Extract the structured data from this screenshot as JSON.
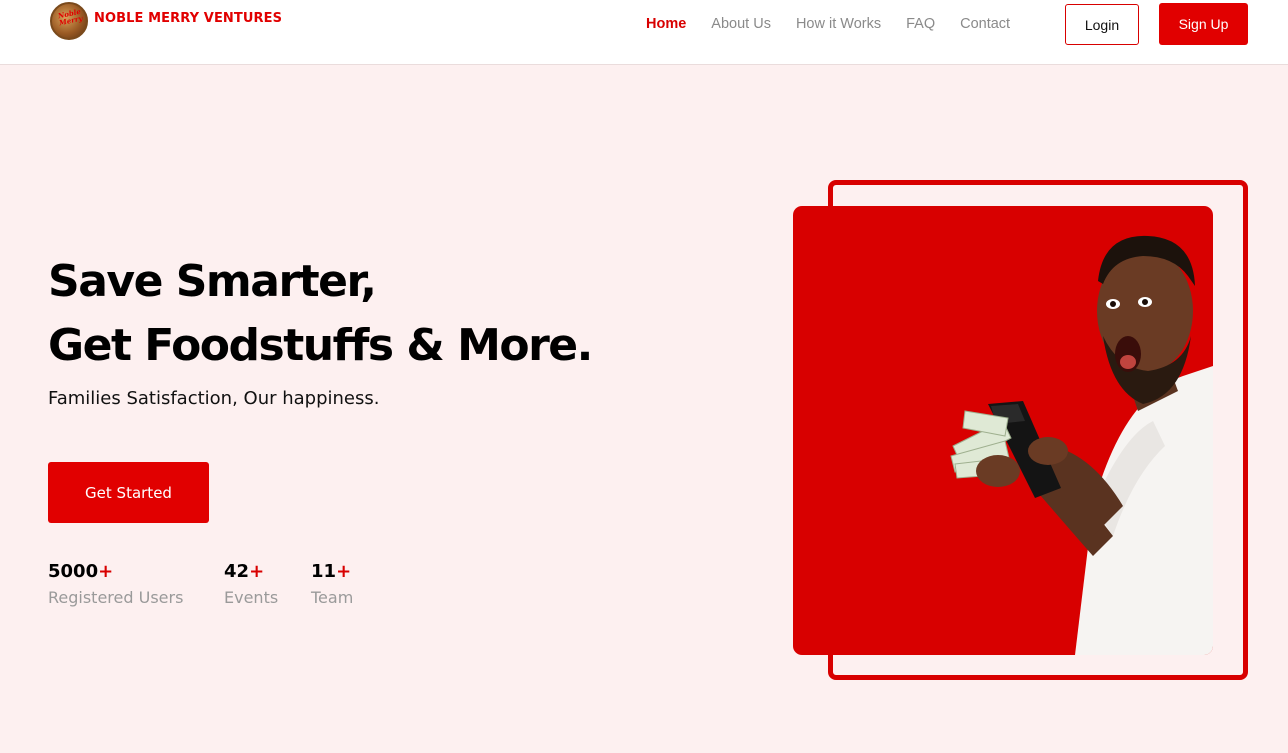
{
  "brand": {
    "name": "NOBLE MERRY VENTURES",
    "badge_text": "Noble Merry"
  },
  "nav": {
    "items": [
      {
        "label": "Home",
        "active": true
      },
      {
        "label": "About Us",
        "active": false
      },
      {
        "label": "How it Works",
        "active": false
      },
      {
        "label": "FAQ",
        "active": false
      },
      {
        "label": "Contact",
        "active": false
      }
    ],
    "login_label": "Login",
    "signup_label": "Sign Up"
  },
  "hero": {
    "title_line1": "Save Smarter,",
    "title_line2": "Get Foodstuffs & More.",
    "subtitle": "Families Satisfaction, Our happiness.",
    "cta_label": "Get Started",
    "image_icon": "man-holding-cash-wallet-photo"
  },
  "stats": [
    {
      "value": "5000",
      "suffix": "+",
      "label": "Registered Users"
    },
    {
      "value": "42",
      "suffix": "+",
      "label": "Events"
    },
    {
      "value": "11",
      "suffix": "+",
      "label": "Team"
    }
  ],
  "colors": {
    "accent": "#e10000",
    "page_background": "#fdf0f0",
    "muted_text": "#9a9a9a"
  }
}
